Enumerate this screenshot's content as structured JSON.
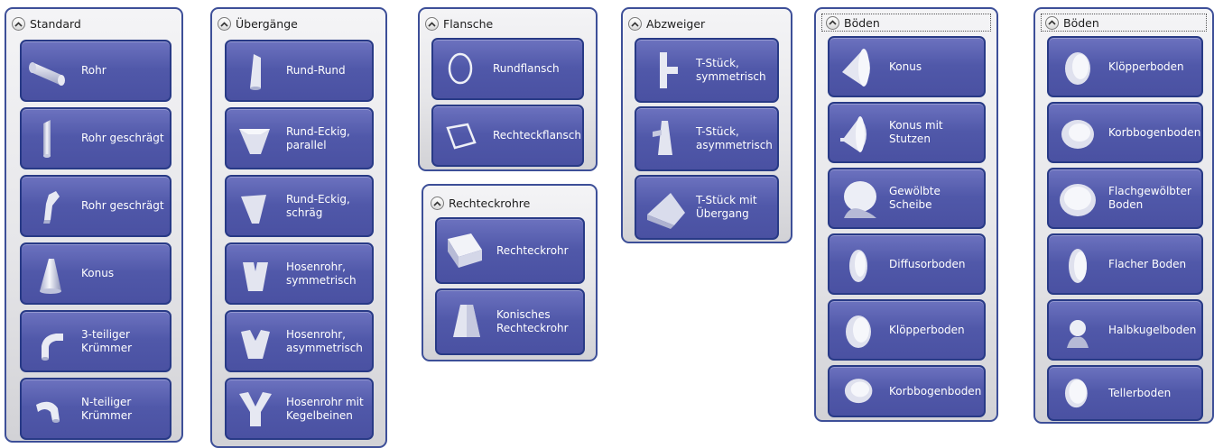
{
  "panels": [
    {
      "title": "Standard",
      "items": [
        "Rohr",
        "Rohr geschrägt",
        "Rohr geschrägt",
        "Konus",
        "3-teiliger\nKrümmer",
        "N-teiliger\nKrümmer"
      ],
      "icons": [
        "pipe-icon",
        "slanted-pipe-icon",
        "slanted-pipe-bent-icon",
        "cone-icon",
        "three-part-elbow-icon",
        "n-part-elbow-icon"
      ]
    },
    {
      "title": "Übergänge",
      "items": [
        "Rund-Rund",
        "Rund-Eckig,\nparallel",
        "Rund-Eckig,\nschräg",
        "Hosenrohr,\nsymmetrisch",
        "Hosenrohr,\nasymmetrisch",
        "Hosenrohr mit\nKegelbeinen"
      ],
      "icons": [
        "round-round-transition-icon",
        "round-square-parallel-icon",
        "round-square-oblique-icon",
        "y-pipe-symmetric-icon",
        "y-pipe-asymmetric-icon",
        "y-pipe-conical-legs-icon"
      ]
    },
    {
      "title": "Flansche",
      "items": [
        "Rundflansch",
        "Rechteckflansch"
      ],
      "icons": [
        "round-flange-icon",
        "rectangular-flange-icon"
      ]
    },
    {
      "title": "Rechteckrohre",
      "items": [
        "Rechteckrohr",
        "Konisches\nRechteckrohr"
      ],
      "icons": [
        "rectangular-pipe-icon",
        "conical-rectangular-pipe-icon"
      ]
    },
    {
      "title": "Abzweiger",
      "items": [
        "T-Stück,\nsymmetrisch",
        "T-Stück,\nasymmetrisch",
        "T-Stück mit\nÜbergang"
      ],
      "icons": [
        "tee-symmetric-icon",
        "tee-asymmetric-icon",
        "tee-transition-icon"
      ]
    },
    {
      "title": "Böden",
      "items": [
        "Konus",
        "Konus mit\nStutzen",
        "Gewölbte\nScheibe",
        "Diffusorboden",
        "Klöpperboden",
        "Korbbogenboden"
      ],
      "icons": [
        "cone-head-icon",
        "cone-nozzle-head-icon",
        "domed-disc-icon",
        "diffuser-head-icon",
        "torispherical-head-icon",
        "semi-ellipsoidal-head-icon"
      ]
    },
    {
      "title": "Böden",
      "items": [
        "Klöpperboden",
        "Korbbogenboden",
        "Flachgewölbter\nBoden",
        "Flacher Boden",
        "Halbkugelboden",
        "Tellerboden"
      ],
      "icons": [
        "torispherical-head-icon",
        "semi-ellipsoidal-head-icon",
        "shallow-domed-head-icon",
        "flat-head-icon",
        "hemispherical-head-icon",
        "dished-head-icon"
      ]
    }
  ],
  "colors": {
    "panel_border": "#3d4f98",
    "tile_fill": "#5058a9",
    "tile_border": "#283a86",
    "label": "#ffffff"
  }
}
